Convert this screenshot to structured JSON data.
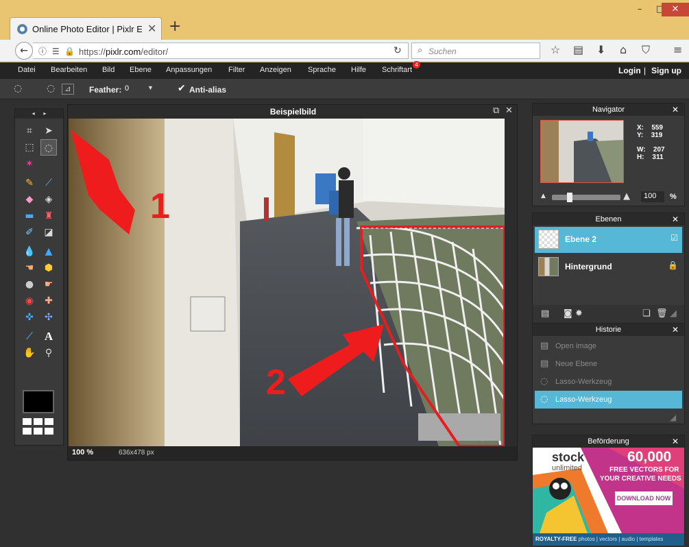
{
  "browser": {
    "tab_title": "Online Photo Editor | Pixlr Ed",
    "tab_close": "✕",
    "new_tab": "+",
    "url_prefix": "https://",
    "url_host": "pixlr.com",
    "url_path": "/editor/",
    "search_placeholder": "Suchen",
    "window": {
      "minimize": "–",
      "maximize": "□",
      "close": "✕"
    }
  },
  "menu": {
    "items": [
      "Datei",
      "Bearbeiten",
      "Bild",
      "Ebene",
      "Anpassungen",
      "Filter",
      "Anzeigen",
      "Sprache",
      "Hilfe",
      "Schriftart"
    ],
    "badge": "4",
    "login": "Login",
    "separator": "|",
    "signup": "Sign up"
  },
  "options": {
    "feather_label": "Feather:",
    "feather_value": "0",
    "antialias_label": "Anti-alias",
    "antialias_checked": true
  },
  "document": {
    "title": "Beispielbild",
    "zoom": "100",
    "zoom_unit": "%",
    "dimensions": "636x478 px"
  },
  "navigator": {
    "title": "Navigator",
    "x_label": "X:",
    "x_value": "559",
    "y_label": "Y:",
    "y_value": "319",
    "w_label": "W:",
    "w_value": "207",
    "h_label": "H:",
    "h_value": "311",
    "zoom_value": "100",
    "zoom_unit": "%"
  },
  "layers": {
    "title": "Ebenen",
    "items": [
      {
        "name": "Ebene 2",
        "active": true
      },
      {
        "name": "Hintergrund",
        "active": false
      }
    ]
  },
  "history": {
    "title": "Historie",
    "items": [
      "Open image",
      "Neue Ebene",
      "Lasso-Werkzeug",
      "Lasso-Werkzeug"
    ],
    "active_index": 3
  },
  "promo": {
    "title": "Beförderung",
    "logo": "stock",
    "logo_sub": "unlimited",
    "count": "60,000",
    "line1": "FREE VECTORS FOR",
    "line2": "YOUR CREATIVE NEEDS",
    "button": "DOWNLOAD NOW",
    "footer_bold": "ROYALTY-FREE",
    "footer_rest": "photos | vectors | audio | templates"
  },
  "annotations": {
    "one": "1",
    "two": "2"
  },
  "colors": {
    "chrome_bg": "#e9c571",
    "app_bg": "#303030",
    "accent": "#57b7d6",
    "annotation": "#ee1c1c",
    "selection": "#e02020"
  }
}
